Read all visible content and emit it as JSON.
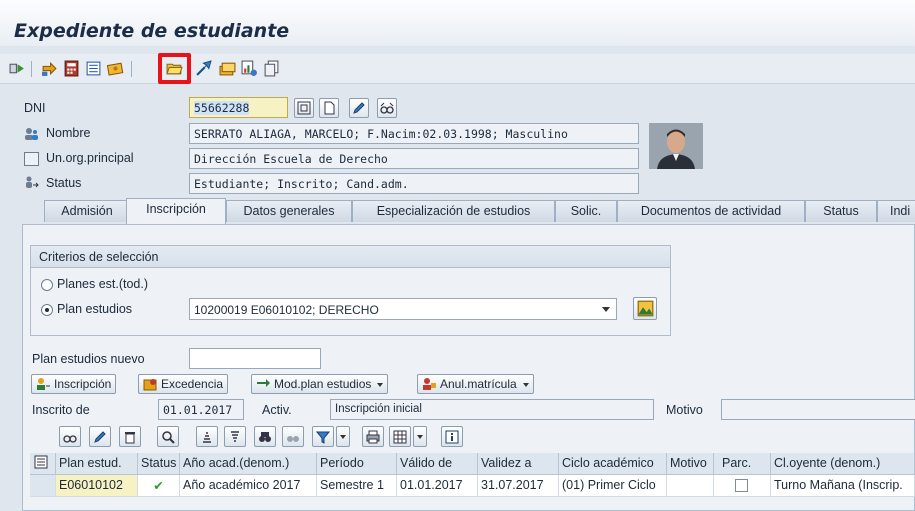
{
  "window": {
    "title": "Expediente de estudiante"
  },
  "header": {
    "dni": {
      "label": "DNI",
      "value": "55662288"
    },
    "nombre": {
      "label": "Nombre",
      "value": "SERRATO ALIAGA, MARCELO; F.Nacim:02.03.1998; Masculino"
    },
    "unorg": {
      "label": "Un.org.principal",
      "value": "Dirección Escuela de Derecho"
    },
    "status": {
      "label": "Status",
      "value": "Estudiante; Inscrito; Cand.adm."
    }
  },
  "tabs": [
    {
      "label": "Admisión"
    },
    {
      "label": "Inscripción"
    },
    {
      "label": "Datos generales"
    },
    {
      "label": "Especialización de estudios"
    },
    {
      "label": "Solic."
    },
    {
      "label": "Documentos de actividad"
    },
    {
      "label": "Status"
    },
    {
      "label": "Indi"
    }
  ],
  "selection": {
    "title": "Criterios de selección",
    "opt_all": "Planes est.(tod.)",
    "opt_plan": "Plan estudios",
    "plan_value": "10200019 E06010102; DERECHO"
  },
  "new_plan": {
    "label": "Plan estudios nuevo",
    "value": ""
  },
  "actions": {
    "inscripcion": "Inscripción",
    "excedencia": "Excedencia",
    "mod_plan": "Mod.plan estudios",
    "anul": "Anul.matrícula"
  },
  "inscrito": {
    "label": "Inscrito de",
    "date": "01.01.2017",
    "activ_label": "Activ.",
    "activ_value": "Inscripción inicial",
    "motivo_label": "Motivo",
    "motivo_value": ""
  },
  "table": {
    "columns": [
      "Plan estud.",
      "Status",
      "Año acad.(denom.)",
      "Período",
      "Válido de",
      "Validez a",
      "Ciclo académico",
      "Motivo",
      "Parc.",
      "Cl.oyente (denom.)"
    ],
    "rows": [
      {
        "plan": "E06010102",
        "status": "✔",
        "anio": "Año académico 2017",
        "periodo": "Semestre 1",
        "valido_de": "01.01.2017",
        "validez_a": "31.07.2017",
        "ciclo": "(01) Primer Ciclo",
        "motivo": "",
        "clase": "Turno Mañana (Inscrip."
      }
    ]
  },
  "colors": {
    "highlight": "#e8121b",
    "accent": "#1b2d48",
    "key_field": "#f7f2c4"
  }
}
